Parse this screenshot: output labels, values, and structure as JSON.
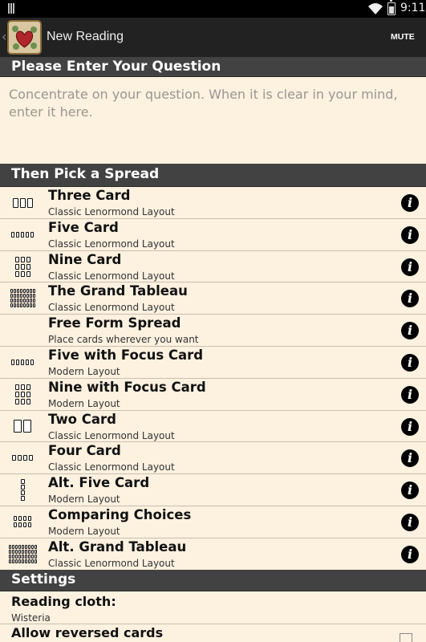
{
  "status_bar": {
    "time": "9:11"
  },
  "action_bar": {
    "title": "New Reading",
    "mute_label": "MUTE"
  },
  "question_section": {
    "header": "Please Enter Your Question",
    "placeholder": "Concentrate on your question. When it is clear in your mind, enter it here."
  },
  "spread_section": {
    "header": "Then Pick a Spread",
    "items": [
      {
        "name": "Three Card",
        "subtitle": "Classic Lenormond Layout",
        "thumb": "three"
      },
      {
        "name": "Five Card",
        "subtitle": "Classic Lenormond Layout",
        "thumb": "five"
      },
      {
        "name": "Nine Card",
        "subtitle": "Classic Lenormond Layout",
        "thumb": "nine"
      },
      {
        "name": "The Grand Tableau",
        "subtitle": "Classic Lenormond Layout",
        "thumb": "grand"
      },
      {
        "name": "Free Form Spread",
        "subtitle": "Place cards wherever you want",
        "thumb": "none"
      },
      {
        "name": "Five with Focus Card",
        "subtitle": "Modern Layout",
        "thumb": "five"
      },
      {
        "name": "Nine with Focus Card",
        "subtitle": "Modern Layout",
        "thumb": "nine"
      },
      {
        "name": "Two Card",
        "subtitle": "Classic Lenormond Layout",
        "thumb": "two"
      },
      {
        "name": "Four Card",
        "subtitle": "Classic Lenormond Layout",
        "thumb": "four"
      },
      {
        "name": "Alt. Five Card",
        "subtitle": "Modern Layout",
        "thumb": "altfive"
      },
      {
        "name": "Comparing Choices",
        "subtitle": "Modern Layout",
        "thumb": "compare"
      },
      {
        "name": "Alt. Grand Tableau",
        "subtitle": "Classic Lenormond Layout",
        "thumb": "altgrand"
      }
    ]
  },
  "settings_section": {
    "header": "Settings",
    "reading_cloth": {
      "label": "Reading cloth:",
      "value": "Wisteria"
    },
    "allow_reversed": {
      "label": "Allow reversed cards",
      "checked": false
    }
  },
  "icons": {
    "info": "info-icon",
    "back": "back-chevron-icon",
    "app": "app-heart-icon",
    "wifi": "wifi-icon",
    "battery": "battery-icon"
  },
  "info_glyph": "i",
  "colors": {
    "background": "#fdf1e0",
    "header": "#424242",
    "action_bar": "#222222"
  }
}
